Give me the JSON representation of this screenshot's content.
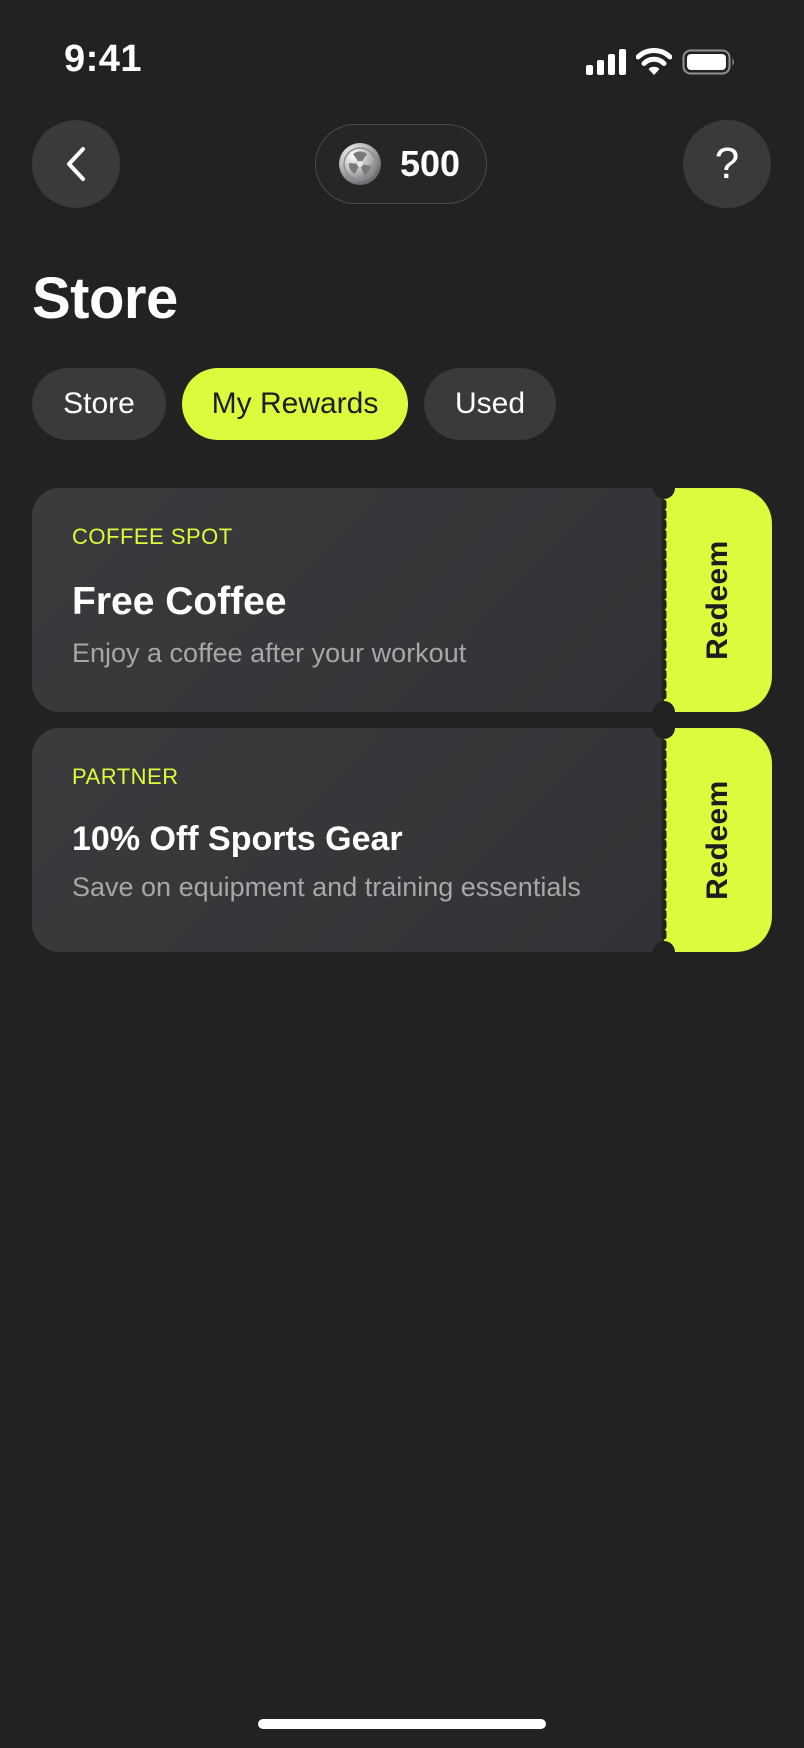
{
  "status_bar": {
    "time": "9:41"
  },
  "header": {
    "back_icon": "chevron-left-icon",
    "points": "500",
    "coin_icon": "coin-icon",
    "help_label": "?"
  },
  "page": {
    "title": "Store"
  },
  "tabs": [
    {
      "label": "Store",
      "active": false
    },
    {
      "label": "My Rewards",
      "active": true
    },
    {
      "label": "Used",
      "active": false
    }
  ],
  "rewards": [
    {
      "category": "COFFEE SPOT",
      "title": "Free Coffee",
      "description": "Enjoy a coffee after your workout",
      "action_label": "Redeem"
    },
    {
      "category": "PARTNER",
      "title": "10% Off Sports Gear",
      "description": "Save on equipment and training essentials",
      "action_label": "Redeem"
    }
  ],
  "colors": {
    "background": "#232223",
    "accent": "#dcfb3d",
    "surface": "#3a393c",
    "muted_text": "#a7a6a9"
  }
}
